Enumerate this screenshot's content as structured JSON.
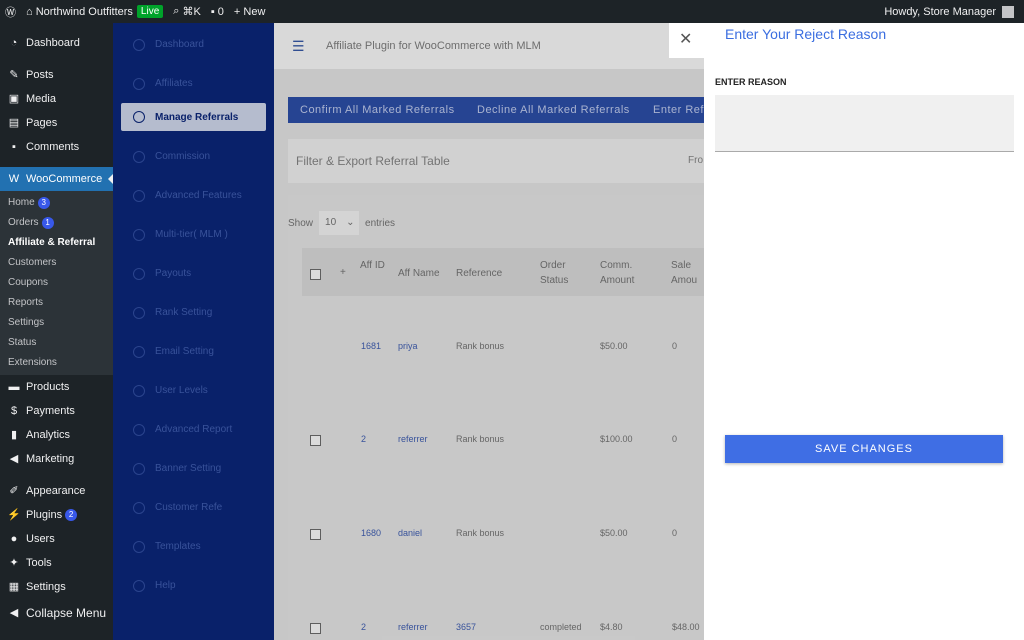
{
  "topbar": {
    "site": "Northwind Outfitters",
    "live": "Live",
    "kbd": "⌘K",
    "comments": "0",
    "new": "New",
    "howdy": "Howdy, Store Manager"
  },
  "wp_menu": {
    "dashboard": "Dashboard",
    "posts": "Posts",
    "media": "Media",
    "pages": "Pages",
    "comments": "Comments",
    "woocommerce": "WooCommerce",
    "woo_sub": [
      {
        "label": "Home",
        "count": "3"
      },
      {
        "label": "Orders",
        "count": "1"
      },
      {
        "label": "Affiliate & Referral"
      },
      {
        "label": "Customers"
      },
      {
        "label": "Coupons"
      },
      {
        "label": "Reports"
      },
      {
        "label": "Settings"
      },
      {
        "label": "Status"
      },
      {
        "label": "Extensions"
      }
    ],
    "products": "Products",
    "payments": "Payments",
    "analytics": "Analytics",
    "marketing": "Marketing",
    "appearance": "Appearance",
    "plugins": "Plugins",
    "plugins_count": "2",
    "users": "Users",
    "tools": "Tools",
    "settings": "Settings",
    "collapse": "Collapse Menu"
  },
  "plugin_menu": [
    "Dashboard",
    "Affiliates",
    "Manage Referrals",
    "Commission",
    "Advanced Features",
    "Multi-tier( MLM )",
    "Payouts",
    "Rank Setting",
    "Email Setting",
    "User Levels",
    "Advanced Report",
    "Banner Setting",
    "Customer Refe",
    "Templates",
    "Help"
  ],
  "page": {
    "title": "Affiliate Plugin for WooCommerce with MLM",
    "btn_confirm": "Confirm All Marked Referrals",
    "btn_decline": "Decline All Marked Referrals",
    "btn_enter": "Enter Ref",
    "filter_title": "Filter & Export Referral Table",
    "filter_from": "Fro",
    "show": "Show",
    "entries_value": "10",
    "entries": "entries"
  },
  "table": {
    "headers": [
      "Aff ID",
      "Aff Name",
      "Reference",
      "Order Status",
      "Comm. Amount",
      "Sale Amou"
    ],
    "rows": [
      {
        "id": "1681",
        "name": "priya",
        "ref": "Rank bonus",
        "status": "",
        "comm": "$50.00",
        "sale": "0"
      },
      {
        "id": "2",
        "name": "referrer",
        "ref": "Rank bonus",
        "status": "",
        "comm": "$100.00",
        "sale": "0"
      },
      {
        "id": "1680",
        "name": "daniel",
        "ref": "Rank bonus",
        "status": "",
        "comm": "$50.00",
        "sale": "0"
      },
      {
        "id": "2",
        "name": "referrer",
        "ref": "3657",
        "status": "completed",
        "comm": "$4.80",
        "sale": "$48.00"
      }
    ]
  },
  "panel": {
    "title": "Enter Your Reject Reason",
    "label": "ENTER REASON",
    "reason_value": "",
    "save": "SAVE CHANGES"
  }
}
